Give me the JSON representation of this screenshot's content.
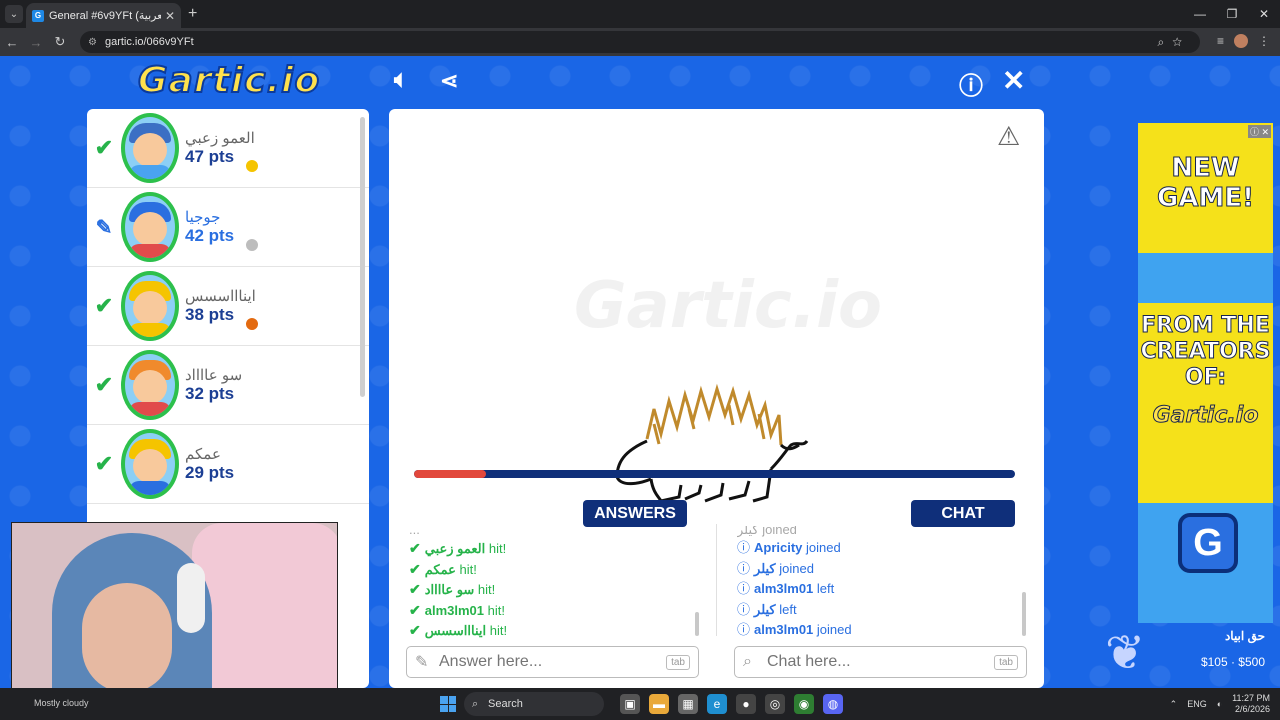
{
  "browser": {
    "tab_title": "General #6v9YFt (العربية) - Gartic",
    "tab_favicon": "G",
    "url": "gartic.io/066v9YFt",
    "new_tab_icon": "+",
    "controls": {
      "minimize": "—",
      "restore": "❐",
      "close": "✕"
    }
  },
  "game": {
    "logo": "Gartic.io",
    "players": [
      {
        "name": "العمو زعبي",
        "points": "47 pts",
        "status": "hit",
        "status_icon": "✔",
        "dot_color": "#f5c400",
        "hair": "#3b6fc4",
        "body": "#4aa3f0"
      },
      {
        "name": "جوجيا",
        "points": "42 pts",
        "status": "drawing",
        "status_icon": "✎",
        "dot_color": "#bdbdbd",
        "hair": "#2a6fe0",
        "body": "#e14b4b"
      },
      {
        "name": "ايناااسسس",
        "points": "38 pts",
        "status": "hit",
        "status_icon": "✔",
        "dot_color": "#e36a10",
        "hair": "#f5c400",
        "body": "#f5c400"
      },
      {
        "name": "سو عااااد",
        "points": "32 pts",
        "status": "hit",
        "status_icon": "✔",
        "dot_color": "",
        "hair": "#f08a2c",
        "body": "#e14b4b"
      },
      {
        "name": "عمكم",
        "points": "29 pts",
        "status": "hit",
        "status_icon": "✔",
        "dot_color": "",
        "hair": "#f5c400",
        "body": "#2a6fe0"
      }
    ],
    "timer_fraction": 0.12,
    "tabs": {
      "answers": "ANSWERS",
      "chat": "CHAT"
    },
    "answers": {
      "faded_line": "...",
      "lines": [
        {
          "name": "العمو زعبي",
          "text": "hit!"
        },
        {
          "name": "عمكم",
          "text": "hit!"
        },
        {
          "name": "سو عااااد",
          "text": "hit!"
        },
        {
          "name": "alm3lm01",
          "text": "hit!"
        },
        {
          "name": "ايناااسسس",
          "text": "hit!"
        }
      ],
      "placeholder": "Answer here...",
      "key_hint": "tab"
    },
    "chat": {
      "faded_line": "كيلر joined",
      "lines": [
        {
          "name": "Apricity",
          "text": "joined"
        },
        {
          "name": "كيلر",
          "text": "joined"
        },
        {
          "name": "alm3lm01",
          "text": "left"
        },
        {
          "name": "كيلر",
          "text": "left"
        },
        {
          "name": "alm3lm01",
          "text": "joined"
        }
      ],
      "placeholder": "Chat here...",
      "key_hint": "tab"
    }
  },
  "ad": {
    "line1": "NEW GAME!",
    "line2": "FROM THE CREATORS OF:",
    "brand": "Gartic.io",
    "button": "G",
    "info_icons": "ⓘ ✕"
  },
  "donation": {
    "name": "حق ابياد",
    "amount": "$105 · $500"
  },
  "taskbar": {
    "weather": "Mostly cloudy",
    "search": "Search",
    "lang": "ENG",
    "time": "11:27 PM",
    "date": "2/6/2026"
  }
}
